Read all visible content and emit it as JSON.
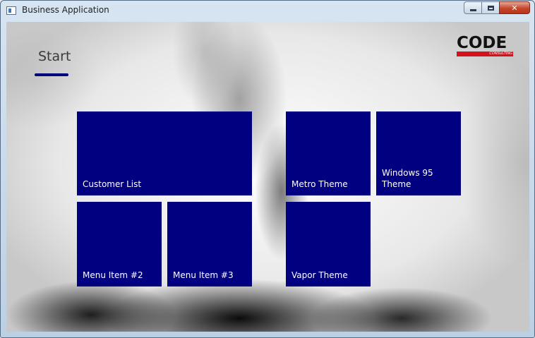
{
  "window": {
    "title": "Business Application",
    "buttons": {
      "minimize": "minimize-icon",
      "maximize": "maximize-icon",
      "close": "✕"
    }
  },
  "page": {
    "title": "Start"
  },
  "logo": {
    "word": "CODE",
    "sub": "CONSULTING"
  },
  "tiles": [
    {
      "label": "Customer List"
    },
    {
      "label": "Metro Theme"
    },
    {
      "label": "Windows 95 Theme"
    },
    {
      "label": "Menu Item #2"
    },
    {
      "label": "Menu Item #3"
    },
    {
      "label": "Vapor Theme"
    }
  ],
  "colors": {
    "tile": "#000080",
    "underline": "#00007a",
    "logo_red": "#d4121c"
  }
}
